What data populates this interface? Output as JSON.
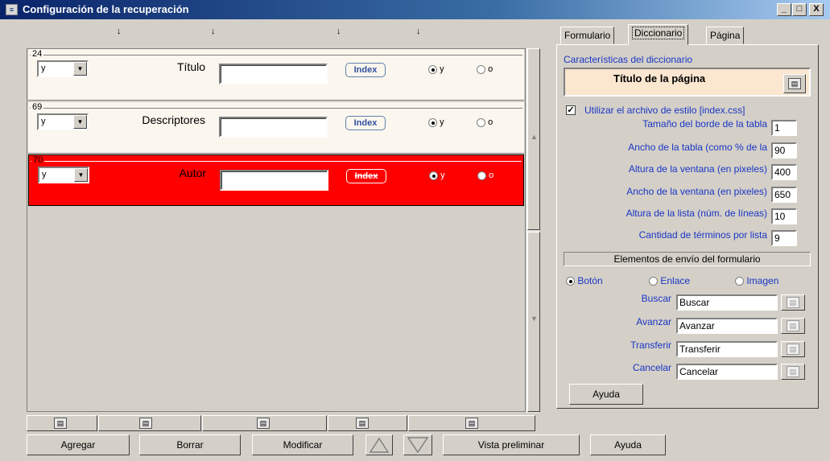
{
  "window": {
    "title": "Configuración de la recuperación",
    "app_icon": "app-icon",
    "controls": [
      "_",
      "□",
      "X"
    ]
  },
  "grid": {
    "column_markers": [
      "↓",
      "↓",
      "↓",
      "↓"
    ],
    "rows": [
      {
        "num": "24",
        "operator": "y",
        "field": "Título",
        "value": "",
        "index_label": "Index",
        "radio_y": "y",
        "radio_o": "o",
        "selected_radio": "y",
        "selected": false
      },
      {
        "num": "69",
        "operator": "y",
        "field": "Descriptores",
        "value": "",
        "index_label": "Index",
        "radio_y": "y",
        "radio_o": "o",
        "selected_radio": "y",
        "selected": false
      },
      {
        "num": "70",
        "operator": "y",
        "field": "Autor",
        "value": "",
        "index_label": "Index",
        "radio_y": "y",
        "radio_o": "o",
        "selected_radio": "y",
        "selected": true
      }
    ],
    "selected_color": "#ff0000"
  },
  "buttons": {
    "add": "Agregar",
    "delete": "Borrar",
    "modify": "Modificar",
    "preview": "Vista preliminar",
    "help": "Ayuda"
  },
  "tabs": [
    "Formulario",
    "Diccionario",
    "Página"
  ],
  "active_tab": "Diccionario",
  "dictionary": {
    "section_title": "Características del diccionario",
    "page_title": "Título de la página",
    "use_stylesheet": "Utilizar el archivo de estilo [index.css]",
    "use_stylesheet_checked": true,
    "settings": [
      {
        "label": "Tamaño del borde de la tabla",
        "value": "1"
      },
      {
        "label": "Ancho de la tabla (como % de la",
        "value": "90"
      },
      {
        "label": "Altura de la ventana (en pixeles)",
        "value": "400"
      },
      {
        "label": "Ancho de la ventana (en pixeles)",
        "value": "650"
      },
      {
        "label": "Altura de la lista (núm. de líneas)",
        "value": "10"
      },
      {
        "label": "Cantidad de términos por lista",
        "value": "9"
      }
    ],
    "submit_section": "Elementos de envío del formulario",
    "submit_types": [
      "Botón",
      "Enlace",
      "Imagen"
    ],
    "submit_selected": "Botón",
    "submit_fields": [
      {
        "label": "Buscar",
        "value": "Buscar"
      },
      {
        "label": "Avanzar",
        "value": "Avanzar"
      },
      {
        "label": "Transferir",
        "value": "Transferir"
      },
      {
        "label": "Cancelar",
        "value": "Cancelar"
      }
    ],
    "help": "Ayuda"
  }
}
